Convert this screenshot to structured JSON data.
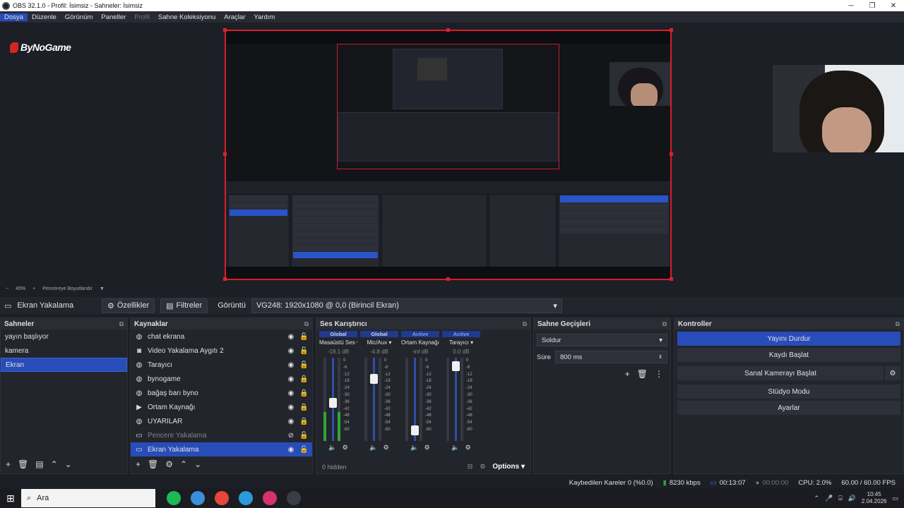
{
  "window": {
    "title": "OBS 32.1.0 - Profil: İsimsiz - Sahneler: İsimsiz",
    "minimize": "─",
    "maximize": "❐",
    "close": "✕"
  },
  "menu": [
    "Dosya",
    "Düzenle",
    "Görünüm",
    "Paneller",
    "Profil",
    "Sahne Koleksiyonu",
    "Araçlar",
    "Yardım"
  ],
  "preview": {
    "logo": "ByNoGame"
  },
  "zoom": {
    "level": "45%",
    "mode": "Pencereye Boyutlandır"
  },
  "source_toolbar": {
    "selected_source": "Ekran Yakalama",
    "properties": "Özellikler",
    "filters": "Filtreler",
    "display_label": "Görüntü",
    "display_value": "VG248: 1920x1080 @ 0,0 (Birincil Ekran)"
  },
  "scenes": {
    "title": "Sahneler",
    "items": [
      "yayın başlıyor",
      "kamera",
      "Ekran"
    ],
    "selected": 2
  },
  "sources": {
    "title": "Kaynaklar",
    "items": [
      {
        "name": "chat ekrana",
        "icon": "browser-icon",
        "glyph": "◍",
        "locked": false,
        "visible": true
      },
      {
        "name": "Video Yakalama Aygıtı 2",
        "icon": "camera-icon",
        "glyph": "◙",
        "locked": false,
        "visible": true
      },
      {
        "name": "Tarayıcı",
        "icon": "browser-icon",
        "glyph": "◍",
        "locked": false,
        "visible": true
      },
      {
        "name": "bynogame",
        "icon": "browser-icon",
        "glyph": "◍",
        "locked": true,
        "visible": true
      },
      {
        "name": "bağaş barı byno",
        "icon": "browser-icon",
        "glyph": "◍",
        "locked": true,
        "visible": true
      },
      {
        "name": "Ortam Kaynağı",
        "icon": "play-icon",
        "glyph": "▶",
        "locked": true,
        "visible": true
      },
      {
        "name": "UYARILAR",
        "icon": "browser-icon",
        "glyph": "◍",
        "locked": true,
        "visible": true
      },
      {
        "name": "Pencere Yakalama",
        "icon": "window-icon",
        "glyph": "▭",
        "locked": false,
        "visible": false
      },
      {
        "name": "Ekran Yakalama",
        "icon": "monitor-icon",
        "glyph": "▭",
        "locked": false,
        "visible": true
      }
    ],
    "selected": 8
  },
  "mixer": {
    "title": "Ses Karıştırıcı",
    "channels": [
      {
        "tag": "Global",
        "name": "Masaüstü Ses",
        "db": "-18.1 dB",
        "fader": 0.45,
        "level": 0.35
      },
      {
        "tag": "Global",
        "name": "Mic/Aux",
        "db": "-4.8 dB",
        "fader": 0.78,
        "level": 0.0
      },
      {
        "tag": "Active",
        "name": "Ortam Kaynağı",
        "db": "-inf dB",
        "fader": 0.08,
        "level": 0.0
      },
      {
        "tag": "Active",
        "name": "Tarayıcı",
        "db": "0.0 dB",
        "fader": 0.95,
        "level": 0.0
      }
    ],
    "scale": [
      "0",
      "-6",
      "-12",
      "-18",
      "-24",
      "-30",
      "-36",
      "-42",
      "-48",
      "-54",
      "-60"
    ],
    "hidden": "0 hidden",
    "options": "Options"
  },
  "transitions": {
    "title": "Sahne Geçişleri",
    "type": "Soldur",
    "duration_label": "Süre",
    "duration": "800 ms"
  },
  "controls": {
    "title": "Kontroller",
    "buttons": [
      "Yayını Durdur",
      "Kaydı Başlat",
      "Sanal Kamerayı Başlat",
      "Stüdyo Modu",
      "Ayarlar"
    ]
  },
  "status": {
    "dropped": "Kaybedilen Kareler 0 (%0.0)",
    "bitrate": "8230 kbps",
    "stream_time": "00:13:07",
    "rec_time": "00:00:00",
    "cpu": "CPU: 2.0%",
    "fps": "60.00 / 60.00 FPS"
  },
  "taskbar": {
    "search": "Ara",
    "time": "10:45",
    "date": "2.04.2026",
    "apps": [
      {
        "name": "spotify-icon",
        "color": "#1db954"
      },
      {
        "name": "files-icon",
        "color": "#3a8fd8"
      },
      {
        "name": "chrome-icon",
        "color": "#e8453c"
      },
      {
        "name": "edge-icon",
        "color": "#2a9ad8"
      },
      {
        "name": "instagram-icon",
        "color": "#d6336c"
      },
      {
        "name": "obs-icon",
        "color": "#3b3d44"
      }
    ]
  },
  "colors": {
    "accent": "#284cb8",
    "preview_border": "#d41f2b",
    "meter_green": "#2da53b"
  }
}
